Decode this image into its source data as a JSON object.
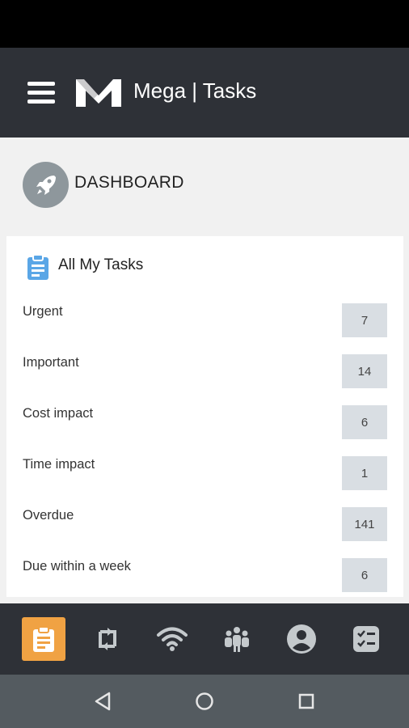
{
  "app": {
    "title": "Mega | Tasks",
    "logo_icon": "mega-m-logo",
    "menu_icon": "hamburger-menu-icon"
  },
  "dashboard": {
    "title": "DASHBOARD",
    "icon": "rocket-icon"
  },
  "tasks": {
    "title": "All My Tasks",
    "icon": "clipboard-icon",
    "rows": [
      {
        "label": "Urgent",
        "count": "7"
      },
      {
        "label": "Important",
        "count": "14"
      },
      {
        "label": "Cost impact",
        "count": "6"
      },
      {
        "label": "Time impact",
        "count": "1"
      },
      {
        "label": "Overdue",
        "count": "141"
      },
      {
        "label": "Due within a week",
        "count": "6"
      }
    ]
  },
  "bottom_nav": [
    {
      "icon": "clipboard-icon",
      "active": true
    },
    {
      "icon": "sync-icon",
      "active": false
    },
    {
      "icon": "wifi-icon",
      "active": false
    },
    {
      "icon": "team-icon",
      "active": false
    },
    {
      "icon": "account-icon",
      "active": false
    },
    {
      "icon": "checklist-icon",
      "active": false
    }
  ],
  "colors": {
    "appbar": "#2e3137",
    "accent": "#f0a243",
    "count_bg": "#d9dee3",
    "dash_icon_bg": "#8e979c",
    "clipboard_blue": "#5aa6e6"
  }
}
